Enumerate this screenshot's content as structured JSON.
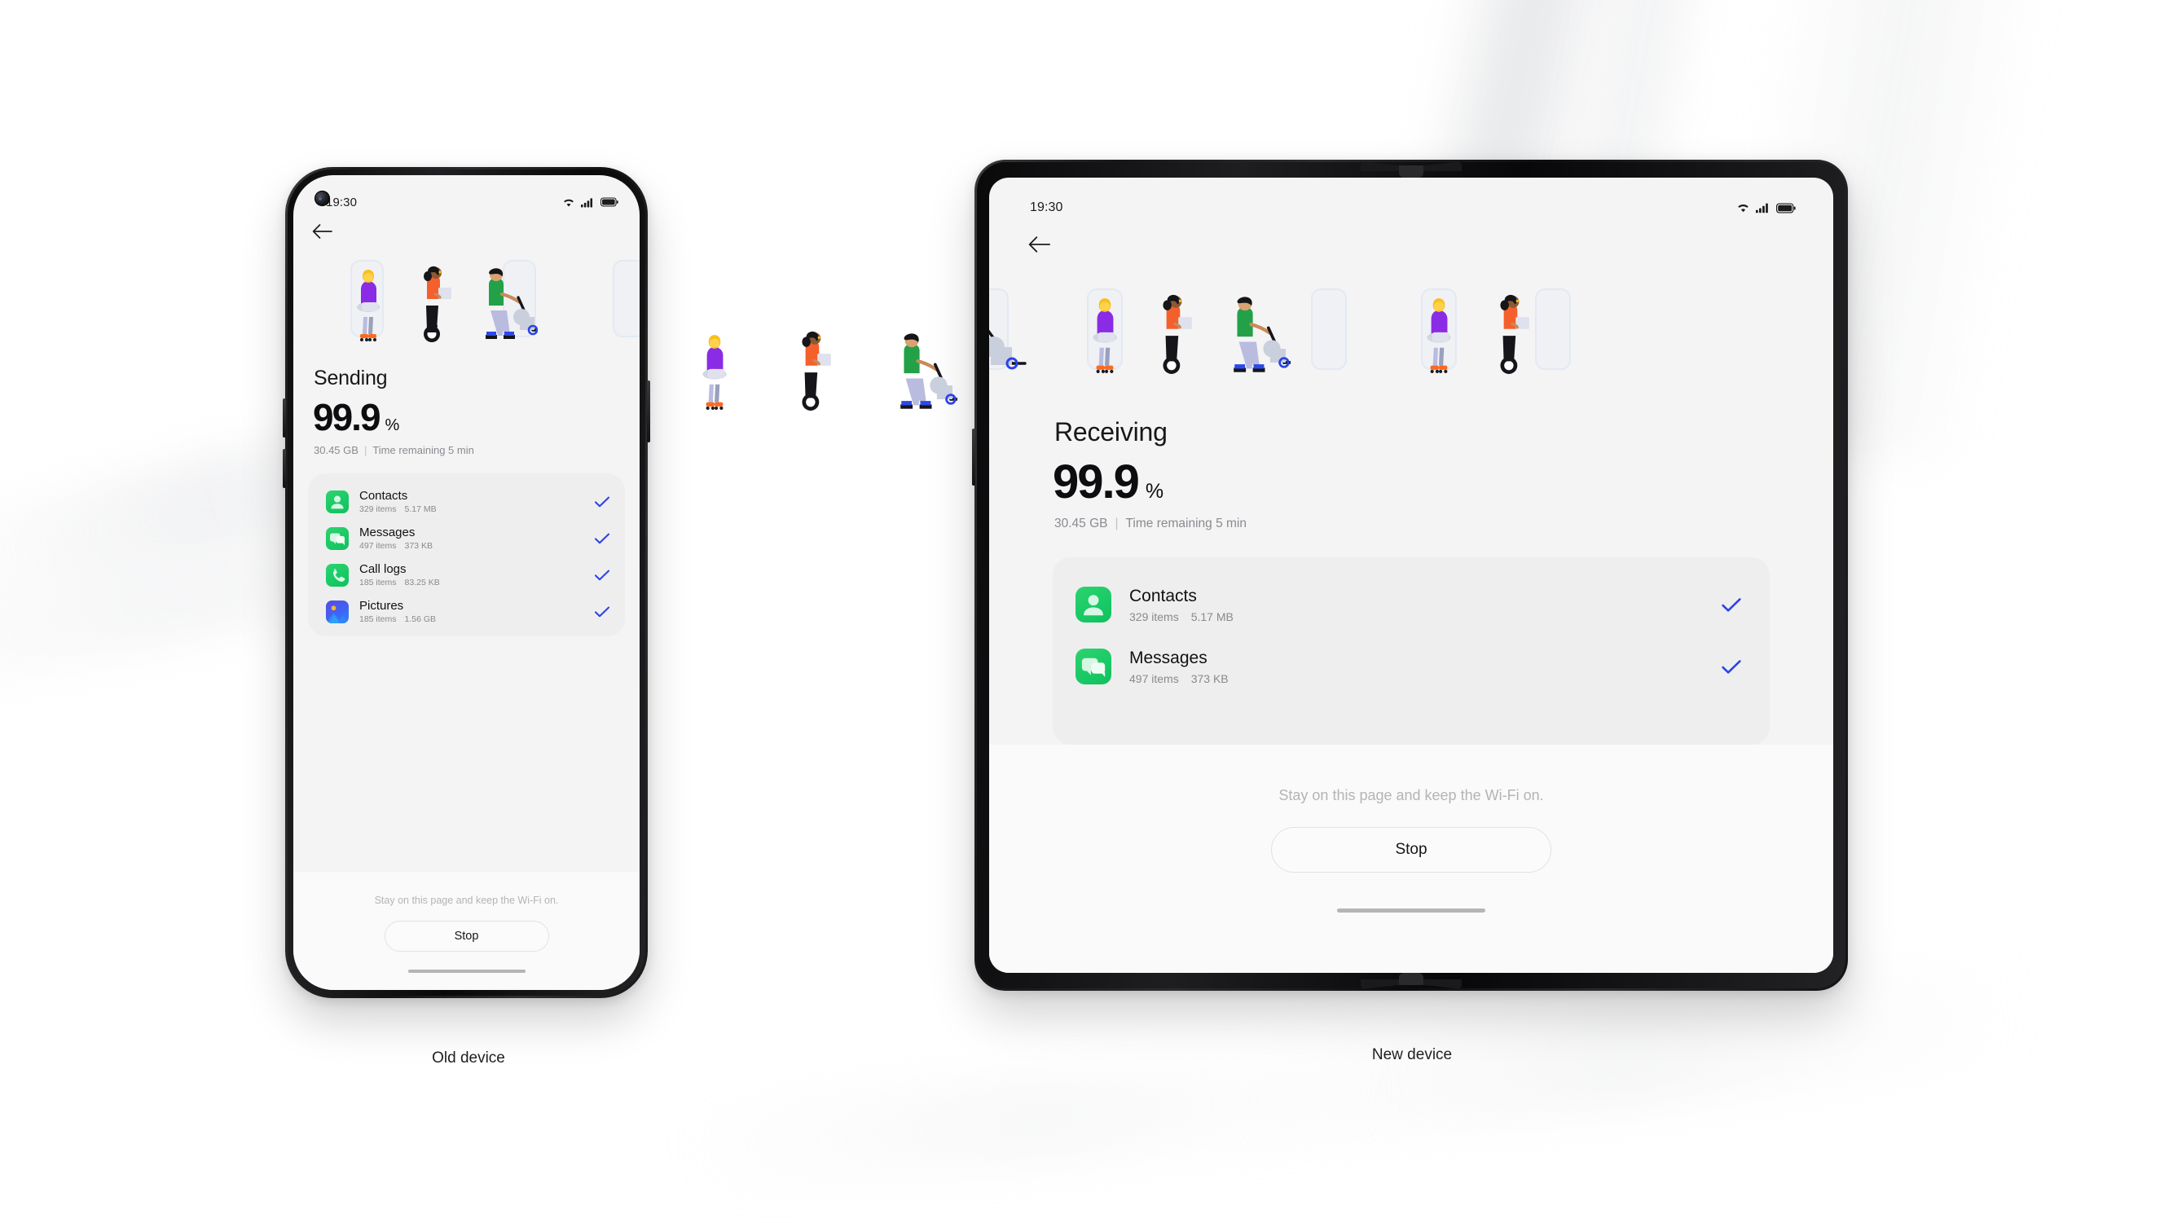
{
  "scene": {
    "background_color": "#ffffff",
    "caption_old": "Old device",
    "caption_new": "New device"
  },
  "old_device": {
    "status": {
      "time": "19:30",
      "icons": [
        "wifi-icon",
        "cellular-signal-icon",
        "battery-icon"
      ]
    },
    "nav": {
      "back_icon": "back-arrow-icon"
    },
    "title": "Sending",
    "progress": {
      "value": "99.9",
      "symbol": "%"
    },
    "meta": {
      "size": "30.45 GB",
      "separator": "|",
      "time_remaining": "Time remaining 5 min"
    },
    "items": [
      {
        "icon": "contacts-icon",
        "icon_color": "#18c965",
        "name": "Contacts",
        "count": "329 items",
        "size": "5.17 MB",
        "status_icon": "check-icon"
      },
      {
        "icon": "messages-icon",
        "icon_color": "#18c965",
        "name": "Messages",
        "count": "497 items",
        "size": "373 KB",
        "status_icon": "check-icon"
      },
      {
        "icon": "phone-icon",
        "icon_color": "#18c965",
        "name": "Call logs",
        "count": "185 items",
        "size": "83.25 KB",
        "status_icon": "check-icon"
      },
      {
        "icon": "pictures-icon",
        "icon_color": "#3f63f5",
        "name": "Pictures",
        "count": "185 items",
        "size": "1.56 GB",
        "status_icon": "check-icon"
      }
    ],
    "hint": "Stay on this page and keep the Wi-Fi on.",
    "stop_label": "Stop"
  },
  "new_device": {
    "status": {
      "time": "19:30",
      "icons": [
        "wifi-icon",
        "cellular-signal-icon",
        "battery-icon"
      ]
    },
    "nav": {
      "back_icon": "back-arrow-icon"
    },
    "title": "Receiving",
    "progress": {
      "value": "99.9",
      "symbol": "%"
    },
    "meta": {
      "size": "30.45 GB",
      "separator": "|",
      "time_remaining": "Time remaining 5 min"
    },
    "items": [
      {
        "icon": "contacts-icon",
        "icon_color": "#18c965",
        "name": "Contacts",
        "count": "329 items",
        "size": "5.17 MB",
        "status_icon": "check-icon"
      },
      {
        "icon": "messages-icon",
        "icon_color": "#18c965",
        "name": "Messages",
        "count": "497 items",
        "size": "373 KB",
        "status_icon": "check-icon"
      }
    ],
    "hint": "Stay on this page and keep the Wi-Fi on.",
    "stop_label": "Stop"
  },
  "colors": {
    "accent_check": "#2b44e8",
    "screen_bg": "#f4f4f5",
    "card_bg": "#eeeeee",
    "icon_green": "#18c965",
    "icon_blue": "#3f63f5",
    "text_primary": "#111113",
    "text_secondary": "#8a8a8f",
    "hint": "#b4b4b8"
  }
}
